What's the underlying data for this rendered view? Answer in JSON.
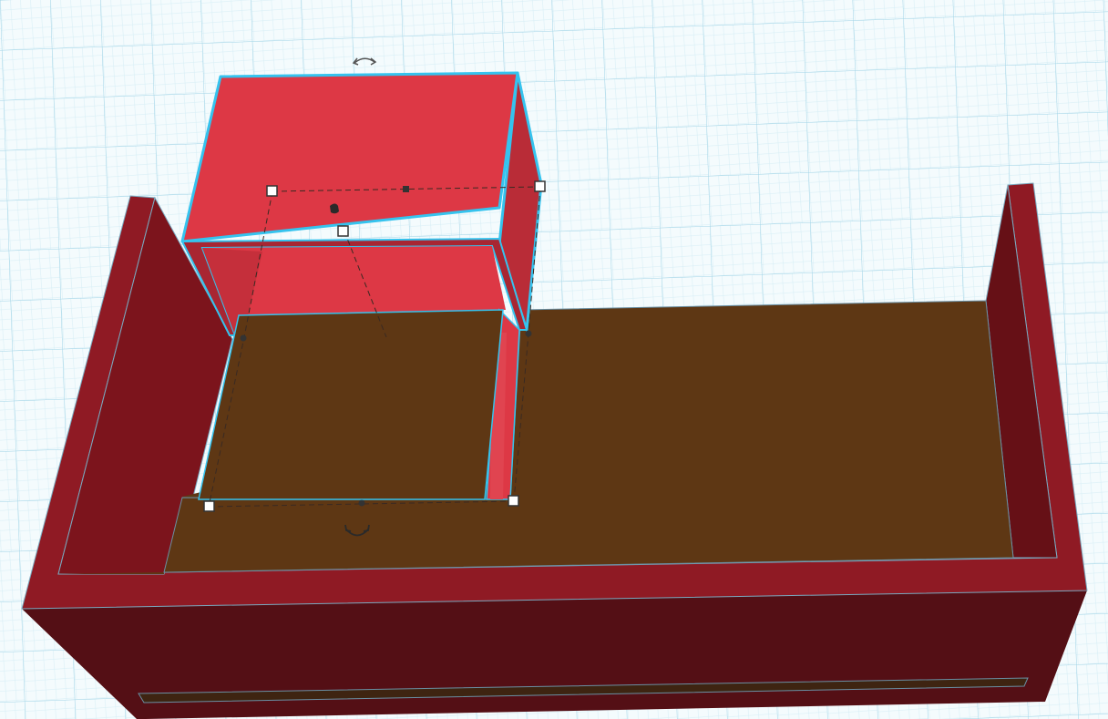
{
  "app": {
    "view": "3d-workplane"
  },
  "workplane": {
    "grid": true,
    "background_color": "#f4fbfd",
    "grid_major_color": "#9fd3e6",
    "grid_minor_color": "#d4edf5"
  },
  "scene": {
    "selected_object": "red-box",
    "selection_outline_color": "#35c3ee",
    "colors": {
      "selected_box_front": "#dd3845",
      "selected_box_side": "#b92c37",
      "base_rim": "#8f1a24",
      "base_front": "#540f15",
      "base_inner_wall": "#7c141c",
      "base_inner_wall_dark": "#661016",
      "floor": "#5e3714",
      "inner_panel": "#5e3714"
    }
  },
  "handles": [
    {
      "name": "resize-handle-back-left",
      "icon": "square-handle"
    },
    {
      "name": "resize-handle-back-right",
      "icon": "square-handle"
    },
    {
      "name": "resize-handle-front-left",
      "icon": "square-handle"
    },
    {
      "name": "resize-handle-front-right",
      "icon": "square-handle"
    },
    {
      "name": "resize-handle-center",
      "icon": "square-handle"
    },
    {
      "name": "resize-handle-back-mid",
      "icon": "small-square-handle"
    },
    {
      "name": "height-handle",
      "icon": "cone-handle"
    }
  ],
  "rotation_handles": [
    {
      "name": "rotate-arrow-top-icon",
      "icon": "rotate-arc-arrow"
    },
    {
      "name": "rotate-arrow-bottom-icon",
      "icon": "rotate-arc-arrow"
    }
  ]
}
